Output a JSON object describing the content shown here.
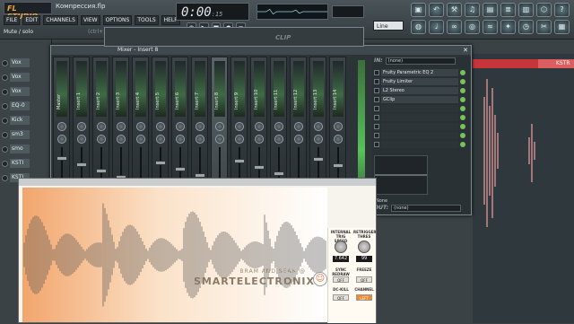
{
  "app": {
    "logo": "FL STUDIO",
    "song_title": "Компрессия.flp",
    "status": "Mute / solo",
    "hint": "(ctrl+)1...",
    "time": "0:00",
    "time_fraction": ":15",
    "snap": "Line"
  },
  "menu": [
    "FILE",
    "EDIT",
    "CHANNELS",
    "VIEW",
    "OPTIONS",
    "TOOLS",
    "HELP"
  ],
  "transport": {
    "play": "▶",
    "stop": "■",
    "rec": "●",
    "pat": "◉",
    "song": "≡"
  },
  "toolbar_icons": [
    "disk-icon",
    "undo-icon",
    "wrench-icon",
    "piano-icon",
    "playlist-icon",
    "mixer-icon",
    "browser-icon",
    "plugin-icon",
    "help-icon",
    "cpu-icon",
    "tempo-icon",
    "link-icon",
    "ring-icon",
    "eq-icon",
    "fx-icon",
    "metro-icon",
    "clip-icon",
    "rack-icon"
  ],
  "channels": [
    "Vox",
    "Vox",
    "Vox",
    "EQ-0",
    "Kick",
    "sm3",
    "smo",
    "KSTI",
    "KSTI"
  ],
  "mixer": {
    "title": "Mixer - Insert 8",
    "inserts": [
      "Master",
      "Insert 1",
      "Insert 2",
      "Insert 3",
      "Insert 4",
      "Insert 5",
      "Insert 6",
      "Insert 7",
      "Insert 8",
      "Insert 9",
      "Insert 10",
      "Insert 11",
      "Insert 12",
      "Insert 13",
      "Insert 14"
    ],
    "selected_index": 8,
    "in_label": "IN:",
    "in_value": "(none)",
    "out_label": "OUT:",
    "out_value": "(none)",
    "fx_slots": [
      "Fruity Parametric EQ 2",
      "Fruity Limiter",
      "L2 Stereo",
      "GClip",
      "",
      "",
      "",
      "",
      ""
    ],
    "none_label": "None"
  },
  "playlist": {
    "track": "KSTR"
  },
  "plugin": {
    "header": "CLIP",
    "credit_small": "BRAM AND SEAN @",
    "credit_big": "SMARTELECTRONIX",
    "input_trim_label": "INTERNAL TRIG SPEED",
    "input_trim_value": "7.642",
    "retrigger_label": "RETRIGGER THRES",
    "retrigger_value": "99",
    "sync_label": "SYNC REDRAW",
    "sync_value": "OFF",
    "freeze_label": "FREEZE",
    "freeze_value": "OFF",
    "dckill_label": "DC-KILL",
    "dckill_value": "OFF",
    "channel_label": "CHANNEL",
    "channel_value": "LEFT"
  },
  "colors": {
    "accent": "#f08a2c",
    "playlist_red": "#c7353b",
    "meter_green": "#57c25a"
  }
}
